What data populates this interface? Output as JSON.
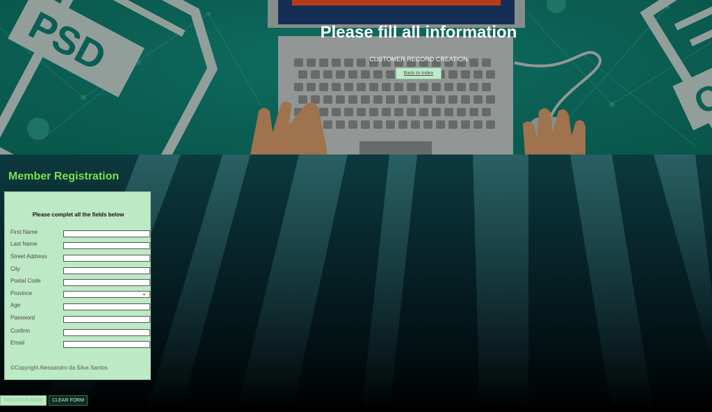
{
  "banner": {
    "title": "Please fill all information",
    "subtitle": "CUSTOMER RECORD CREATION",
    "back_link": "Back to Index",
    "art_labels": {
      "left_doc": "PSD",
      "right_doc": "CSS"
    }
  },
  "section": {
    "title": "Member Registration"
  },
  "form": {
    "heading": "Please complet all the fields below",
    "fields": [
      {
        "label": "First Name",
        "type": "text",
        "value": ""
      },
      {
        "label": "Last Name",
        "type": "text",
        "value": ""
      },
      {
        "label": "Street Address",
        "type": "text",
        "value": ""
      },
      {
        "label": "City",
        "type": "text",
        "value": ""
      },
      {
        "label": "Postal Code",
        "type": "text",
        "value": ""
      },
      {
        "label": "Province",
        "type": "select",
        "value": ""
      },
      {
        "label": "Age",
        "type": "text",
        "value": ""
      },
      {
        "label": "Password",
        "type": "password",
        "value": ""
      },
      {
        "label": "Confirm",
        "type": "password",
        "value": ""
      },
      {
        "label": "Email",
        "type": "text",
        "value": ""
      }
    ],
    "copyright": "©Copyright Alessandro da Silva Santos"
  },
  "buttons": {
    "register": "REGISTER NOW",
    "clear": "CLEAR FORM"
  },
  "colors": {
    "accent_green": "#7de04a",
    "form_bg": "#bde9c4",
    "banner_teal": "#0c6458"
  }
}
